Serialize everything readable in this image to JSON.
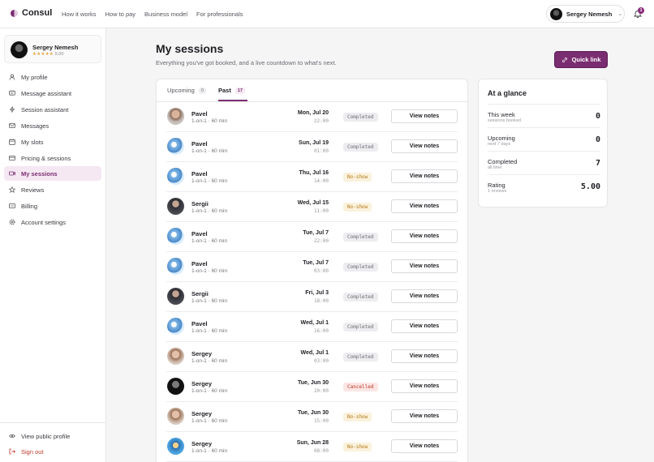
{
  "brand": {
    "name": "Consul"
  },
  "topnav": [
    "How it works",
    "How to pay",
    "Business model",
    "For professionals"
  ],
  "user": {
    "name": "Sergey Nemesh",
    "notifications": "1",
    "rating": "5.00",
    "stars": "★★★★★"
  },
  "sidebar": {
    "items": [
      {
        "label": "My profile",
        "icon": "user-icon"
      },
      {
        "label": "Message assistant",
        "icon": "message-icon"
      },
      {
        "label": "Session assistant",
        "icon": "bolt-icon"
      },
      {
        "label": "Messages",
        "icon": "mail-icon"
      },
      {
        "label": "My slots",
        "icon": "calendar-icon"
      },
      {
        "label": "Pricing & sessions",
        "icon": "card-icon"
      },
      {
        "label": "My sessions",
        "icon": "video-icon",
        "active": true
      },
      {
        "label": "Reviews",
        "icon": "star-icon"
      },
      {
        "label": "Billing",
        "icon": "billing-icon"
      },
      {
        "label": "Account settings",
        "icon": "gear-icon"
      }
    ],
    "footer": {
      "view_public": "View public profile",
      "sign_out": "Sign out"
    }
  },
  "main": {
    "title": "My sessions",
    "subtitle": "Everything you've got booked, and a live countdown to what's next.",
    "quick_link": "Quick link",
    "tabs": [
      {
        "label": "Upcoming",
        "count": "0"
      },
      {
        "label": "Past",
        "count": "17"
      }
    ],
    "view_notes_label": "View notes",
    "sessions": [
      {
        "name": "Pavel",
        "meta": "1-on-1 · 60 min",
        "date": "Mon, Jul 20",
        "time": "22:00",
        "status": "Completed",
        "avatar": "photo"
      },
      {
        "name": "Pavel",
        "meta": "1-on-1 · 60 min",
        "date": "Sun, Jul 19",
        "time": "01:00",
        "status": "Completed",
        "avatar": "robot"
      },
      {
        "name": "Pavel",
        "meta": "1-on-1 · 60 min",
        "date": "Thu, Jul 16",
        "time": "14:00",
        "status": "No-show",
        "avatar": "robot"
      },
      {
        "name": "Sergii",
        "meta": "1-on-1 · 60 min",
        "date": "Wed, Jul 15",
        "time": "11:00",
        "status": "No-show",
        "avatar": "suit"
      },
      {
        "name": "Pavel",
        "meta": "1-on-1 · 60 min",
        "date": "Tue, Jul 7",
        "time": "22:00",
        "status": "Completed",
        "avatar": "robot"
      },
      {
        "name": "Pavel",
        "meta": "1-on-1 · 60 min",
        "date": "Tue, Jul 7",
        "time": "03:00",
        "status": "Completed",
        "avatar": "robot"
      },
      {
        "name": "Sergii",
        "meta": "1-on-1 · 60 min",
        "date": "Fri, Jul 3",
        "time": "18:00",
        "status": "Completed",
        "avatar": "suit"
      },
      {
        "name": "Pavel",
        "meta": "1-on-1 · 60 min",
        "date": "Wed, Jul 1",
        "time": "16:00",
        "status": "Completed",
        "avatar": "robot"
      },
      {
        "name": "Sergey",
        "meta": "1-on-1 · 60 min",
        "date": "Wed, Jul 1",
        "time": "03:00",
        "status": "Completed",
        "avatar": "woman"
      },
      {
        "name": "Sergey",
        "meta": "1-on-1 · 60 min",
        "date": "Tue, Jun 30",
        "time": "20:00",
        "status": "Cancelled",
        "avatar": "dark"
      },
      {
        "name": "Sergey",
        "meta": "1-on-1 · 60 min",
        "date": "Tue, Jun 30",
        "time": "15:00",
        "status": "No-show",
        "avatar": "woman"
      },
      {
        "name": "Sergey",
        "meta": "1-on-1 · 60 min",
        "date": "Sun, Jun 28",
        "time": "08:00",
        "status": "No-show",
        "avatar": "cartoon"
      }
    ]
  },
  "glance": {
    "title": "At a glance",
    "rows": [
      {
        "label": "This week",
        "sub": "sessions booked",
        "value": "0"
      },
      {
        "label": "Upcoming",
        "sub": "next 7 days",
        "value": "0"
      },
      {
        "label": "Completed",
        "sub": "all time",
        "value": "7"
      },
      {
        "label": "Rating",
        "sub": "1 reviews",
        "value": "5.00"
      }
    ]
  },
  "colors": {
    "accent": "#7a2d70",
    "accent_soft": "#f6e8f3",
    "noshow": "#b07a12",
    "cancelled": "#c0392b"
  }
}
